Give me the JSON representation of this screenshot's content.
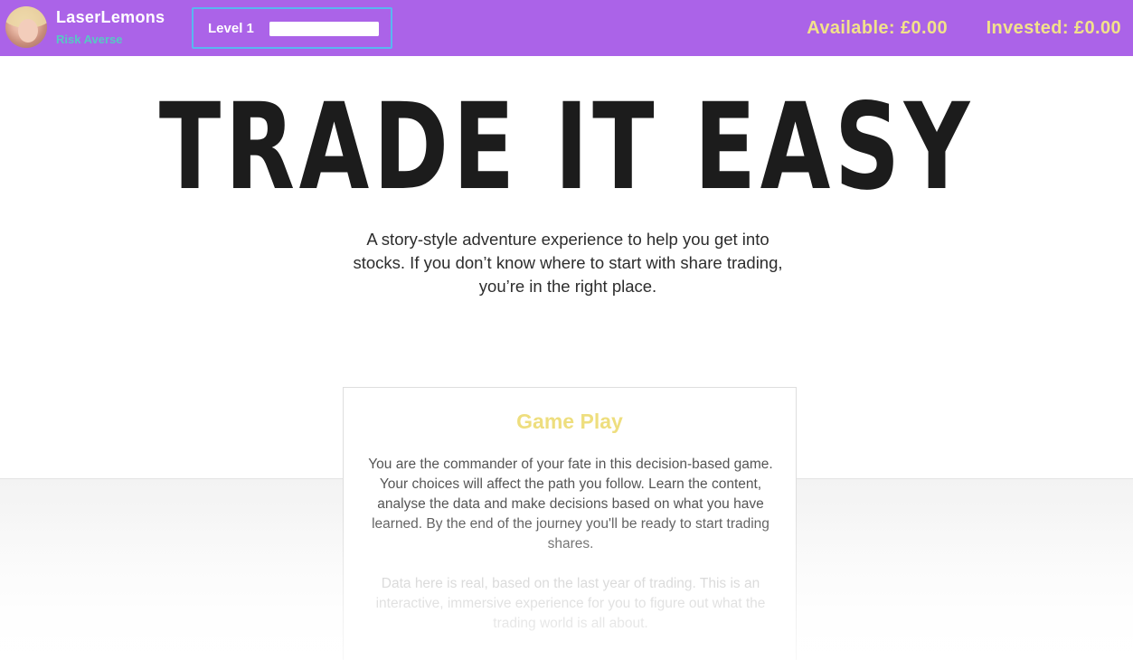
{
  "player": {
    "username": "LaserLemons",
    "risk_profile": "Risk Averse",
    "level_label": "Level 1",
    "level_progress": 1.0
  },
  "account": {
    "available": "Available: £0.00",
    "invested": "Invested: £0.00"
  },
  "hero": {
    "title": "TRADE IT EASY",
    "subtitle": "A story-style adventure experience to help you get into stocks. If you don’t know where to start with share trading, you’re in the right place."
  },
  "card": {
    "title": "Game Play",
    "paragraph_1": "You are the commander of your fate in this decision-based game. Your choices will affect the path you follow. Learn the content, analyse the data and make decisions based on what you have learned. By the end of the journey you'll be ready to start trading shares.",
    "paragraph_2": "Data here is real, based on the last year of trading. This is an interactive, immersive experience for you to figure out what the trading world is all about."
  },
  "colors": {
    "topbar": "#ab63e8",
    "money": "#f2e18a",
    "risk": "#56c9c4",
    "level_border": "#59b7f0",
    "card_title": "#eede7e"
  }
}
